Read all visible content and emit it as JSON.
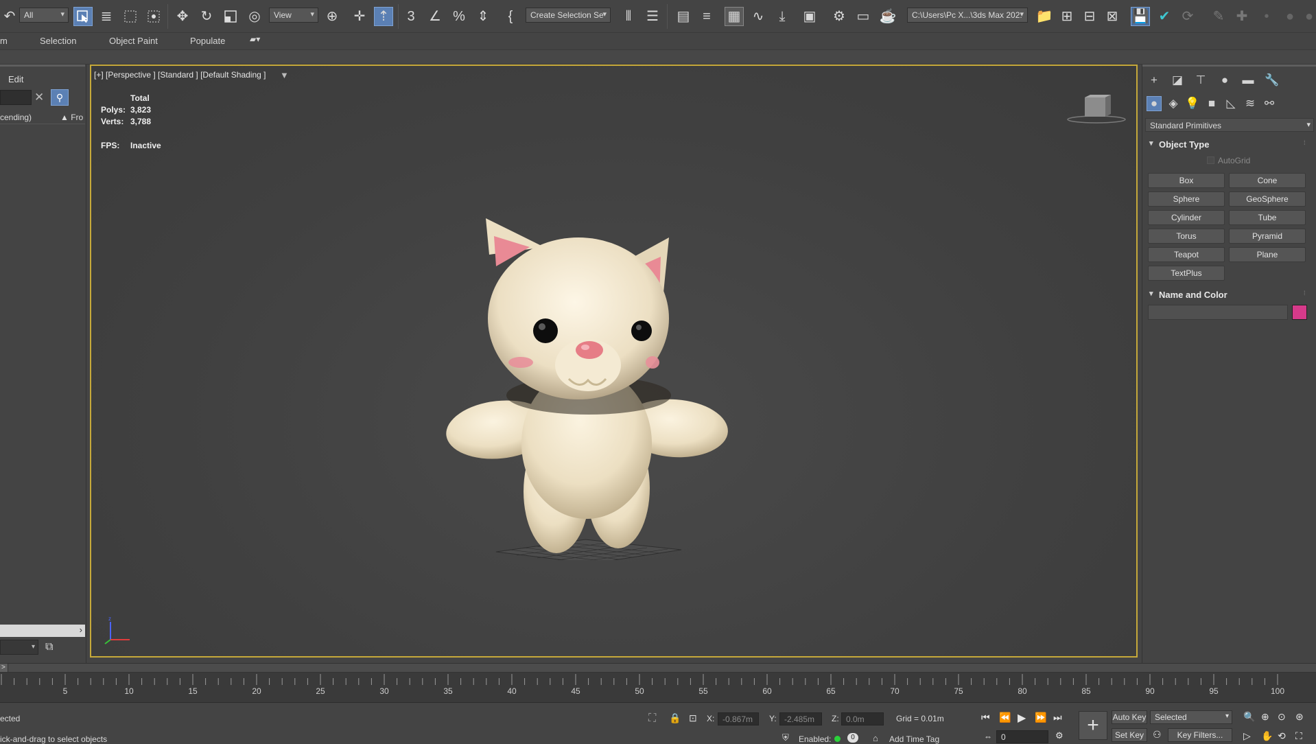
{
  "toolbar": {
    "selection_filter": "All",
    "ref_coord_system": "View",
    "selection_set_placeholder": "Create Selection Se",
    "project_path": "C:\\Users\\Pc X...\\3ds Max 202:"
  },
  "menubar": {
    "items": [
      "m",
      "Selection",
      "Object Paint",
      "Populate"
    ]
  },
  "scene_explorer": {
    "tab": "Edit",
    "sort_label": "cending)",
    "sort_col2": "▲ Fro"
  },
  "viewport": {
    "label": "[+] [Perspective ] [Standard ] [Default Shading ]",
    "stats_header": "Total",
    "polys_label": "Polys:",
    "polys_value": "3,823",
    "verts_label": "Verts:",
    "verts_value": "3,788",
    "fps_label": "FPS:",
    "fps_value": "Inactive"
  },
  "command_panel": {
    "category": "Standard Primitives",
    "object_type_title": "Object Type",
    "autogrid_label": "AutoGrid",
    "primitives": [
      "Box",
      "Cone",
      "Sphere",
      "GeoSphere",
      "Cylinder",
      "Tube",
      "Torus",
      "Pyramid",
      "Teapot",
      "Plane",
      "TextPlus"
    ],
    "name_color_title": "Name and Color",
    "object_color": "#d63a8a"
  },
  "timeline": {
    "ticks": [
      "5",
      "10",
      "15",
      "20",
      "25",
      "30",
      "35",
      "40",
      "45",
      "50",
      "55",
      "60",
      "65",
      "70",
      "75",
      "80",
      "85",
      "90",
      "95",
      "100"
    ]
  },
  "statusbar": {
    "selection_status": "ected",
    "prompt": "ick-and-drag to select objects",
    "x_label": "X:",
    "x_value": "-0.867m",
    "y_label": "Y:",
    "y_value": "-2.485m",
    "z_label": "Z:",
    "z_value": "0.0m",
    "grid": "Grid = 0.01m",
    "enabled_label": "Enabled:",
    "enabled_count": "0",
    "add_time_tag": "Add Time Tag",
    "auto_key": "Auto Key",
    "set_key": "Set Key",
    "key_mode": "Selected",
    "key_filters": "Key Filters...",
    "frame": "0"
  },
  "colors": {
    "active_viewport_border": "#c6a93a",
    "active_tool": "#5b80b4",
    "model_body": "#efe3c8",
    "ear_inner": "#e98a95"
  }
}
